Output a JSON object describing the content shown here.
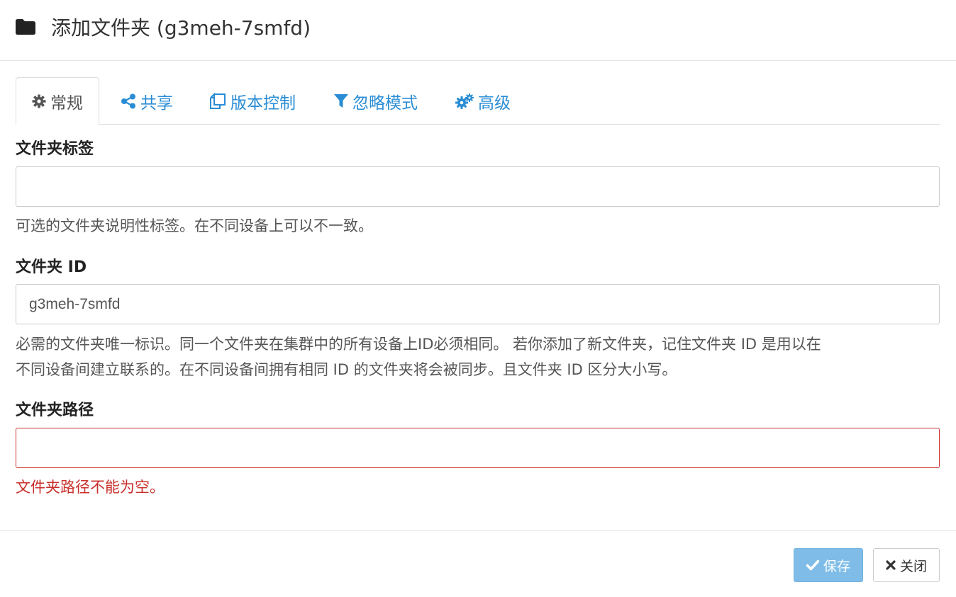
{
  "header": {
    "title": "添加文件夹 (g3meh-7smfd)",
    "icon": "folder-icon"
  },
  "tabs": [
    {
      "label": "常规",
      "icon": "gear-icon",
      "active": true
    },
    {
      "label": "共享",
      "icon": "share-icon",
      "active": false
    },
    {
      "label": "版本控制",
      "icon": "copy-icon",
      "active": false
    },
    {
      "label": "忽略模式",
      "icon": "filter-icon",
      "active": false
    },
    {
      "label": "高级",
      "icon": "cogs-icon",
      "active": false
    }
  ],
  "form": {
    "folder_label": {
      "label": "文件夹标签",
      "value": "",
      "help": "可选的文件夹说明性标签。在不同设备上可以不一致。"
    },
    "folder_id": {
      "label": "文件夹 ID",
      "value": "g3meh-7smfd",
      "help_line1": "必需的文件夹唯一标识。同一个文件夹在集群中的所有设备上ID必须相同。 若你添加了新文件夹，记住文件夹 ID 是用以在",
      "help_line2": "不同设备间建立联系的。在不同设备间拥有相同 ID 的文件夹将会被同步。且文件夹 ID 区分大小写。"
    },
    "folder_path": {
      "label": "文件夹路径",
      "value": "",
      "error": "文件夹路径不能为空。"
    }
  },
  "footer": {
    "save_label": "保存",
    "close_label": "关闭"
  },
  "colors": {
    "link": "#2a8dd4",
    "error": "#c9302c",
    "save_button": "#7fbde8"
  }
}
